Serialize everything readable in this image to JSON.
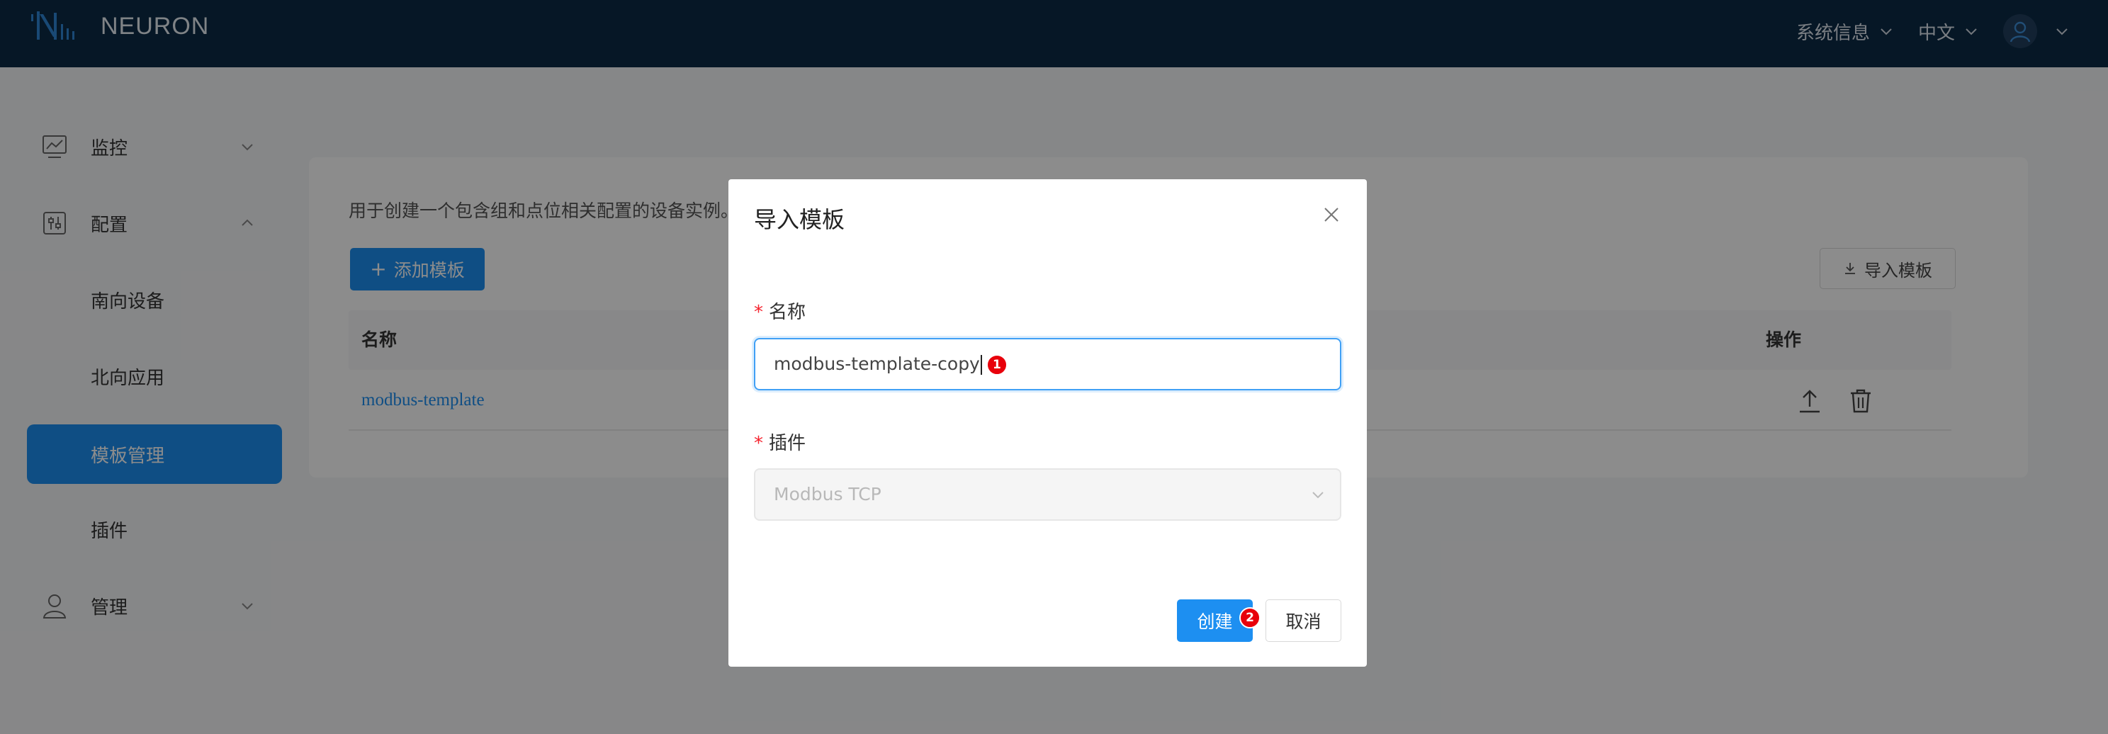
{
  "app": {
    "brand": "NEURON"
  },
  "header": {
    "system_info": "系统信息",
    "language": "中文"
  },
  "sidebar": {
    "items": [
      {
        "label": "监控",
        "icon": "monitor-icon",
        "expanded": false
      },
      {
        "label": "配置",
        "icon": "config-icon",
        "expanded": true
      },
      {
        "label": "南向设备"
      },
      {
        "label": "北向应用"
      },
      {
        "label": "模板管理",
        "active": true
      },
      {
        "label": "插件"
      },
      {
        "label": "管理",
        "icon": "user-icon",
        "expanded": false
      }
    ]
  },
  "main": {
    "description": "用于创建一个包含组和点位相关配置的设备实例。",
    "add_button": "添加模板",
    "import_button": "导入模板",
    "table": {
      "columns": [
        "名称",
        "操作"
      ],
      "rows": [
        {
          "name": "modbus-template"
        }
      ]
    }
  },
  "modal": {
    "title": "导入模板",
    "name_label": "名称",
    "name_value": "modbus-template-copy",
    "plugin_label": "插件",
    "plugin_value": "Modbus TCP",
    "create_button": "创建",
    "cancel_button": "取消",
    "badges": [
      "1",
      "2"
    ]
  },
  "colors": {
    "header_bg": "#0c2a45",
    "primary": "#1d8ff1",
    "required": "#f5222d",
    "badge": "#e8000b"
  }
}
